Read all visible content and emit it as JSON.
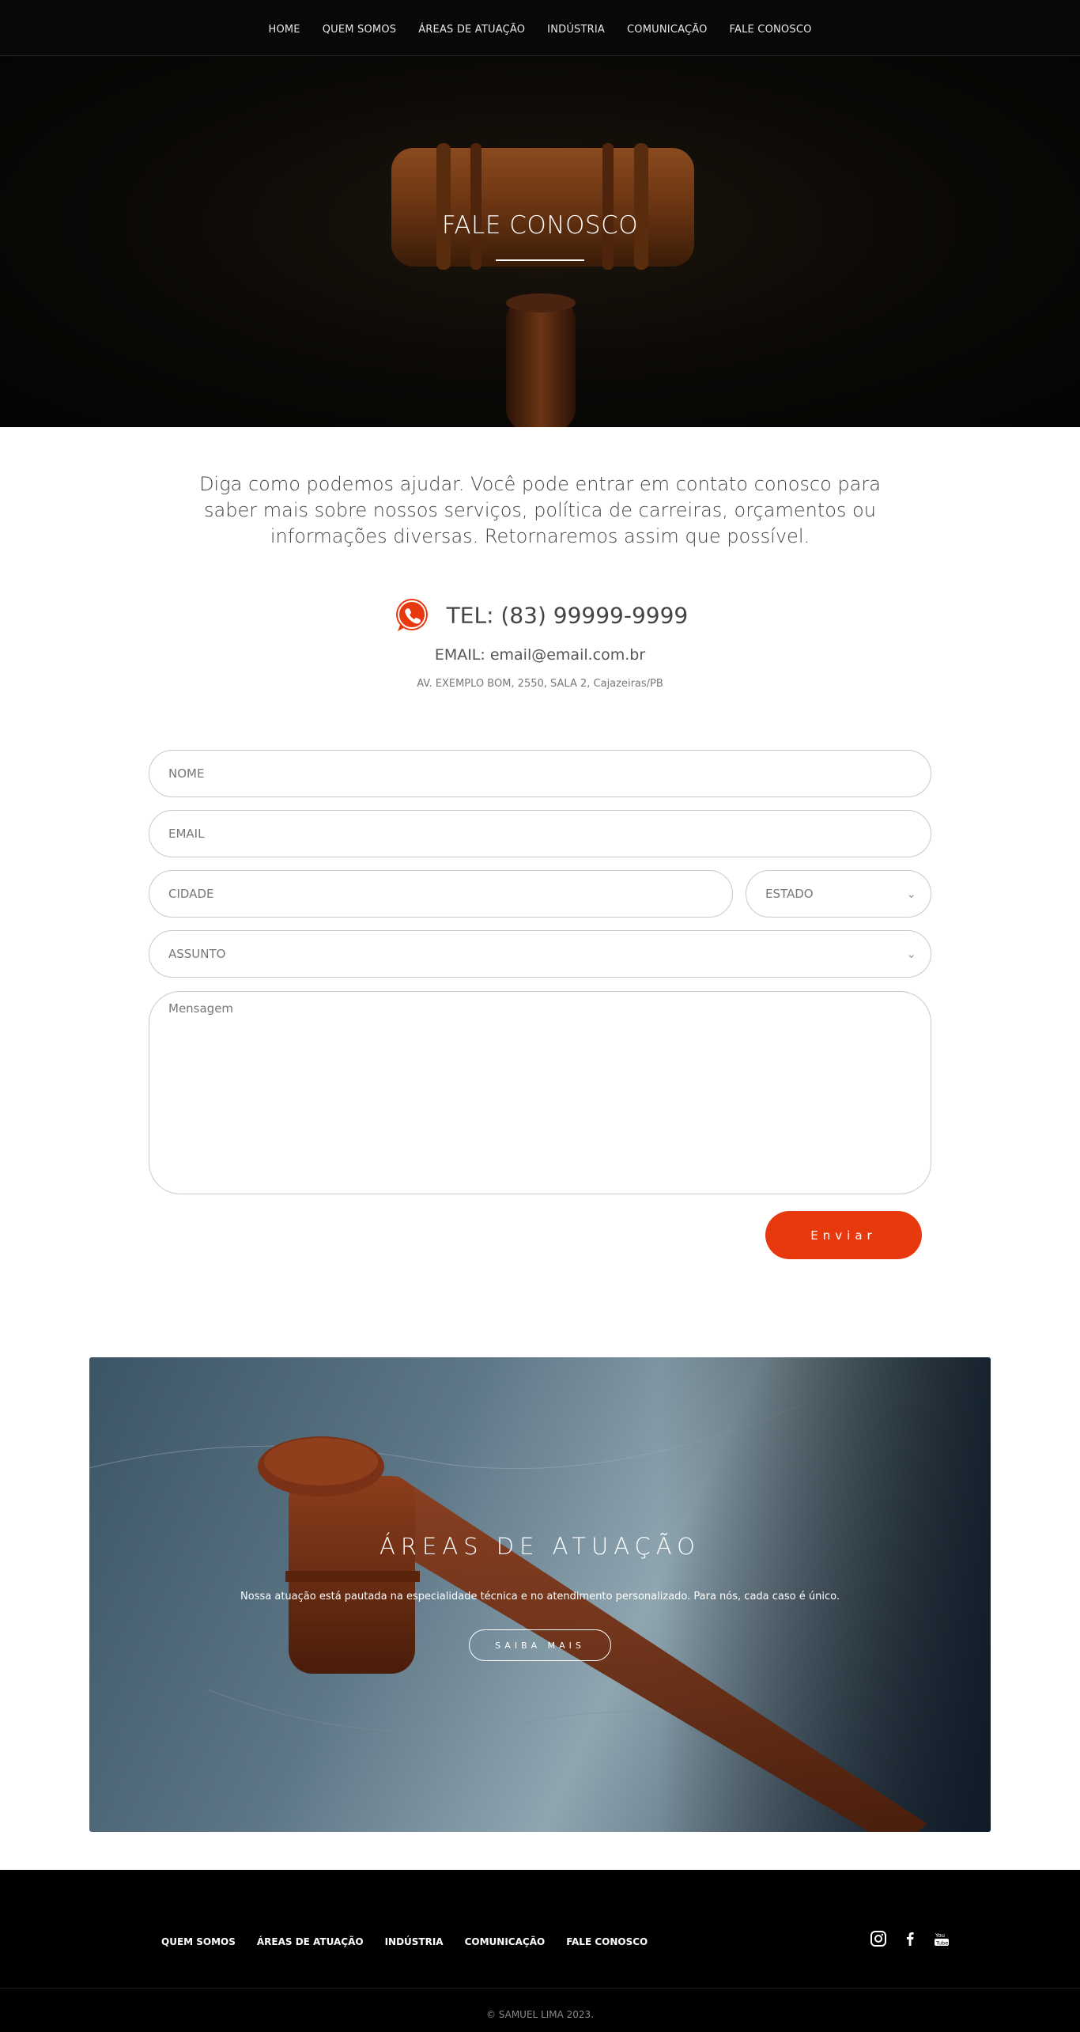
{
  "nav": {
    "items": [
      {
        "label": "HOME"
      },
      {
        "label": "QUEM SOMOS"
      },
      {
        "label": "ÁREAS DE ATUAÇÃO"
      },
      {
        "label": "INDÚSTRIA"
      },
      {
        "label": "COMUNICAÇÃO"
      },
      {
        "label": "FALE CONOSCO"
      }
    ]
  },
  "hero": {
    "title": "FALE CONOSCO"
  },
  "intro": {
    "text": "Diga como podemos ajudar. Você pode entrar em contato conosco para saber mais sobre nossos serviços, política de carreiras, orçamentos ou informações diversas. Retornaremos assim que possível."
  },
  "contact": {
    "phone": "TEL: (83) 99999-9999",
    "email": "EMAIL: email@email.com.br",
    "address": "AV. EXEMPLO BOM, 2550, SALA 2, Cajazeiras/PB",
    "phone_icon": "whatsapp-icon"
  },
  "form": {
    "nome_placeholder": "NOME",
    "email_placeholder": "EMAIL",
    "cidade_placeholder": "CIDADE",
    "estado_label": "ESTADO",
    "assunto_label": "ASSUNTO",
    "mensagem_placeholder": "Mensagem",
    "send_label": "Enviar",
    "accent_color": "#e8380d"
  },
  "areas": {
    "title": "ÁREAS DE ATUAÇÃO",
    "text": "Nossa atuação está pautada na especialidade técnica e no atendimento personalizado. Para nós, cada caso é único.",
    "button_label": "SAIBA MAIS"
  },
  "footer": {
    "items": [
      {
        "label": "QUEM SOMOS"
      },
      {
        "label": "ÁREAS DE ATUAÇÃO"
      },
      {
        "label": "INDÚSTRIA"
      },
      {
        "label": "COMUNICAÇÃO"
      },
      {
        "label": "FALE CONOSCO"
      }
    ],
    "social": [
      "instagram-icon",
      "facebook-icon",
      "youtube-icon"
    ],
    "copyright": "© SAMUEL LIMA 2023."
  }
}
